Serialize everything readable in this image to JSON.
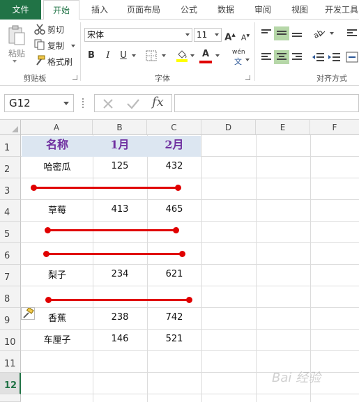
{
  "tabs": [
    {
      "label": "文件"
    },
    {
      "label": "开始"
    },
    {
      "label": "插入"
    },
    {
      "label": "页面布局"
    },
    {
      "label": "公式"
    },
    {
      "label": "数据"
    },
    {
      "label": "审阅"
    },
    {
      "label": "视图"
    },
    {
      "label": "开发工具"
    }
  ],
  "clipboard": {
    "paste": "粘贴",
    "cut": "剪切",
    "copy": "复制",
    "format_painter": "格式刷",
    "group": "剪贴板"
  },
  "font": {
    "name": "宋体",
    "size": "11",
    "bold": "B",
    "italic": "I",
    "underline": "U",
    "wen": "wén",
    "group": "字体"
  },
  "alignment": {
    "group": "对齐方式"
  },
  "formula_bar": {
    "name_box": "G12",
    "fx": "fx",
    "value": ""
  },
  "columns": [
    "A",
    "B",
    "C",
    "D",
    "E",
    "F"
  ],
  "rows": [
    "1",
    "2",
    "3",
    "4",
    "5",
    "6",
    "7",
    "8",
    "9",
    "10",
    "11",
    "12"
  ],
  "table": {
    "headers": [
      "名称",
      "1月",
      "2月"
    ],
    "rows": [
      {
        "name": "哈密瓜",
        "jan": "125",
        "feb": "432"
      },
      {
        "name": "草莓",
        "jan": "413",
        "feb": "465"
      },
      {
        "name": "梨子",
        "jan": "234",
        "feb": "621"
      },
      {
        "name": "香蕉",
        "jan": "238",
        "feb": "742"
      },
      {
        "name": "车厘子",
        "jan": "146",
        "feb": "521"
      }
    ]
  },
  "colors": {
    "accent": "#217346",
    "header_fill": "#dce6f1",
    "header_text": "#7030a0",
    "annotation": "#e00000"
  },
  "watermark": "Bai 经验"
}
